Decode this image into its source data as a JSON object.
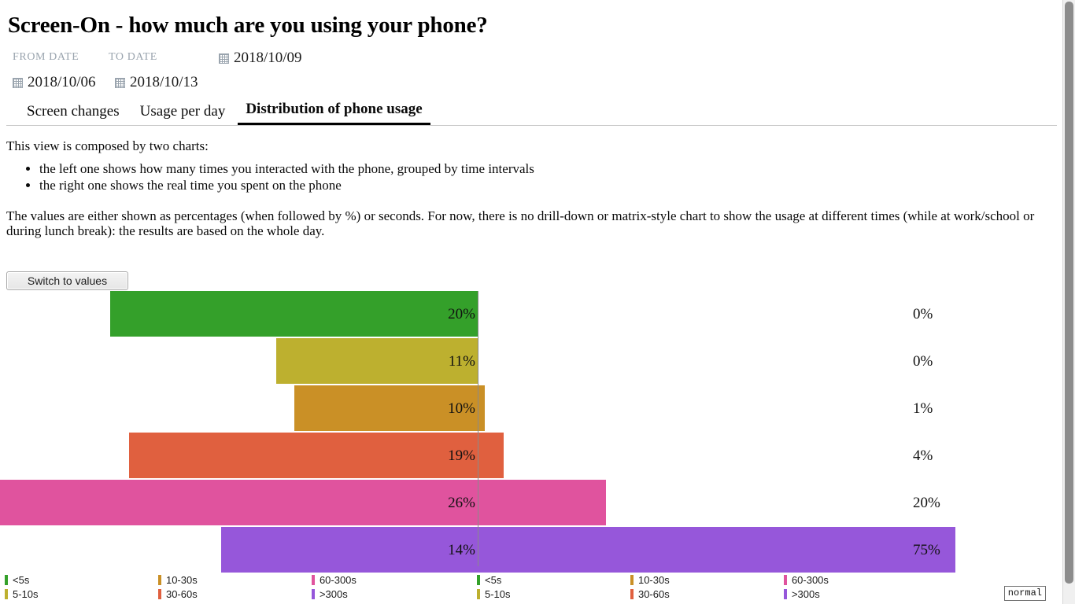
{
  "header": {
    "title": "Screen-On - how much are you using your phone?"
  },
  "date_controls": {
    "from_label": "FROM DATE",
    "to_label": "TO DATE",
    "from_value": "2018/10/06",
    "to_value": "2018/10/13",
    "selected_value": "2018/10/09",
    "icon": "calendar-icon"
  },
  "tabs": [
    {
      "label": "Screen changes",
      "active": false
    },
    {
      "label": "Usage per day",
      "active": false
    },
    {
      "label": "Distribution of phone usage",
      "active": true
    }
  ],
  "description": {
    "intro": "This view is composed by two charts:",
    "bullets": [
      "the left one shows how many times you interacted with the phone, grouped by time intervals",
      "the right one shows the real time you spent on the phone"
    ],
    "note": "The values are either shown as percentages (when followed by %) or seconds. For now, there is no drill-down or matrix-style chart to show the usage at different times (while at work/school or during lunch break): the results are based on the whole day."
  },
  "toolbar": {
    "switch_label": "Switch to values"
  },
  "status": {
    "mode": "normal"
  },
  "colors": {
    "lt5s": "#34a02a",
    "s5_10": "#bdb02f",
    "s10_30": "#ca9026",
    "s30_60": "#e0603f",
    "s60_300": "#e0539e",
    "gt300": "#9657da",
    "axis": "#8a8a8a"
  },
  "legend": {
    "items": [
      {
        "label": "<5s",
        "color": "#34a02a"
      },
      {
        "label": "10-30s",
        "color": "#ca9026"
      },
      {
        "label": "60-300s",
        "color": "#e0539e"
      },
      {
        "label": "5-10s",
        "color": "#bdb02f"
      },
      {
        "label": "30-60s",
        "color": "#e0603f"
      },
      {
        "label": ">300s",
        "color": "#9657da"
      }
    ]
  },
  "chart_data": [
    {
      "type": "bar",
      "title": "Number of interactions by time interval",
      "orientation": "horizontal-left",
      "xlabel": "",
      "ylabel": "",
      "categories": [
        "<5s",
        "5-10s",
        "10-30s",
        "30-60s",
        "60-300s",
        ">300s"
      ],
      "values": [
        20,
        11,
        10,
        19,
        26,
        14
      ],
      "labels": [
        "20%",
        "11%",
        "10%",
        "19%",
        "26%",
        "14%"
      ],
      "colors": [
        "#34a02a",
        "#bdb02f",
        "#ca9026",
        "#e0603f",
        "#e0539e",
        "#9657da"
      ],
      "unit": "%",
      "xlim": [
        0,
        26
      ],
      "grid": false,
      "legend_position": "bottom"
    },
    {
      "type": "bar",
      "title": "Real time spent on the phone by time interval",
      "orientation": "horizontal-right",
      "xlabel": "",
      "ylabel": "",
      "categories": [
        "<5s",
        "5-10s",
        "10-30s",
        "30-60s",
        "60-300s",
        ">300s"
      ],
      "values": [
        0,
        0,
        1,
        4,
        20,
        75
      ],
      "labels": [
        "0%",
        "0%",
        "1%",
        "4%",
        "20%",
        "75%"
      ],
      "colors": [
        "#34a02a",
        "#bdb02f",
        "#ca9026",
        "#e0603f",
        "#e0539e",
        "#9657da"
      ],
      "unit": "%",
      "xlim": [
        0,
        75
      ],
      "grid": false,
      "legend_position": "bottom"
    }
  ]
}
